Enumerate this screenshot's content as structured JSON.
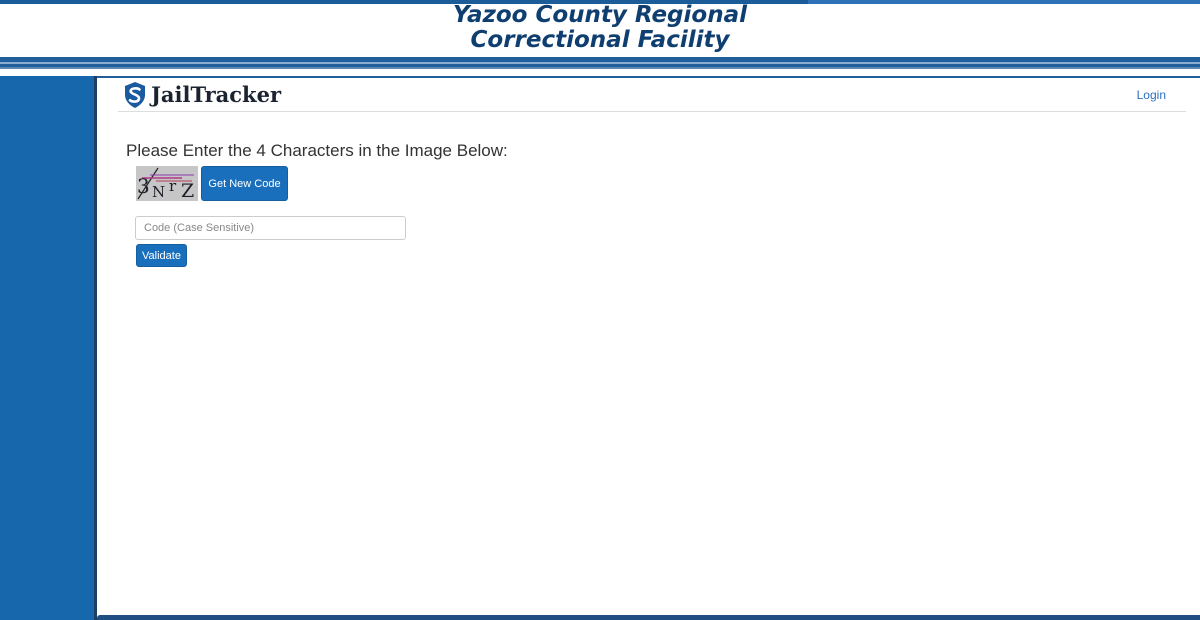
{
  "banner": {
    "title_line1": "Yazoo County Regional",
    "title_line2": "Correctional Facility"
  },
  "navbar": {
    "brand_prefix": "Jail",
    "brand_suffix": "Tracker",
    "login_label": "Login"
  },
  "main": {
    "heading": "Please Enter the 4 Characters in the Image Below:",
    "captcha_text": "3NrZ",
    "get_new_code_label": "Get New Code",
    "code_placeholder": "Code (Case Sensitive)",
    "validate_label": "Validate"
  },
  "colors": {
    "accent": "#1a6fbd",
    "sidebar": "#1767ad",
    "banner_title": "#0f3e70"
  }
}
